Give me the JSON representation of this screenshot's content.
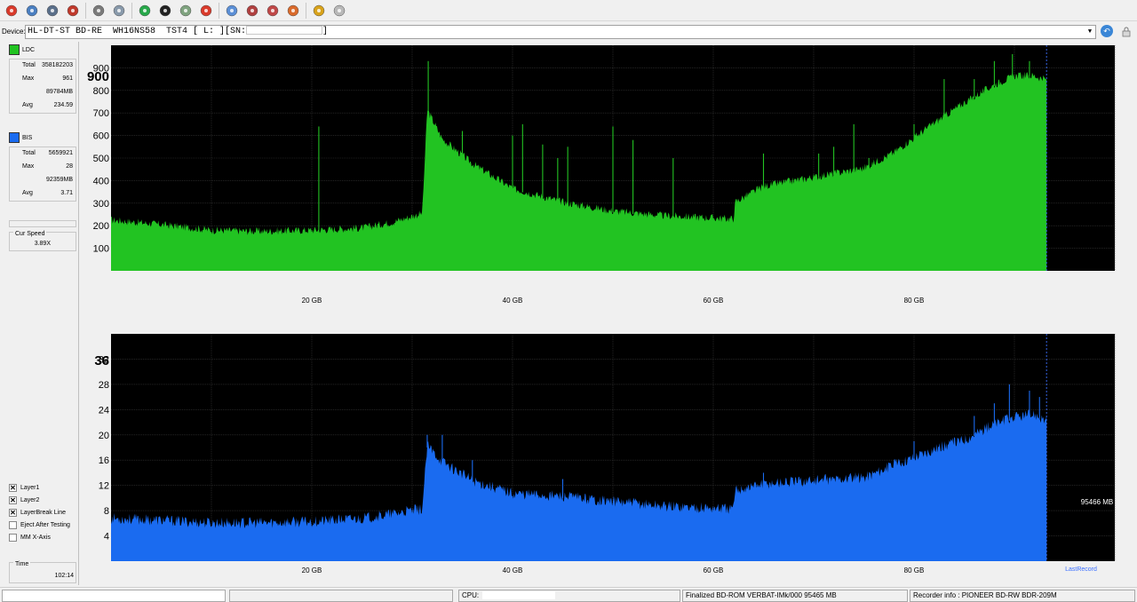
{
  "toolbar": {
    "buttons": [
      {
        "icon": "power-icon",
        "color": "#d93a2b"
      },
      {
        "icon": "disc-info-icon",
        "color": "#4a7fc1"
      },
      {
        "icon": "drive-icon",
        "color": "#5a6f8a"
      },
      {
        "icon": "erase-disc-icon",
        "color": "#c0392b"
      },
      {
        "icon": "drive-tray-icon",
        "color": "#7a7a7a"
      },
      {
        "icon": "copy-drive-icon",
        "color": "#8899aa"
      },
      {
        "icon": "refresh-icon",
        "color": "#27a84a"
      },
      {
        "icon": "start-icon",
        "color": "#222222"
      },
      {
        "icon": "rescan-icon",
        "color": "#7fa37f"
      },
      {
        "icon": "stop-icon",
        "color": "#d93a2b"
      },
      {
        "icon": "disc-blue-icon",
        "color": "#5b8fd6"
      },
      {
        "icon": "burn-disc-icon",
        "color": "#b04040"
      },
      {
        "icon": "disc-scan-icon",
        "color": "#c04848"
      },
      {
        "icon": "settings-disc-icon",
        "color": "#d96a2b"
      },
      {
        "icon": "chart-icon",
        "color": "#d8a21a"
      },
      {
        "icon": "tool-icon",
        "color": "#b8b8b8"
      }
    ]
  },
  "device": {
    "label": "Device:",
    "value_prefix": "HL-DT-ST BD-RE  WH16NS58  TST4 [ L: ][SN:",
    "value_suffix": "]"
  },
  "ldc": {
    "name": "LDC",
    "color": "#22c322",
    "total_label": "Total",
    "total": "358182203",
    "max_label": "Max",
    "max": "961",
    "max_pos": "89784MB",
    "avg_label": "Avg",
    "avg": "234.59"
  },
  "bis": {
    "name": "BIS",
    "color": "#1a6bf0",
    "total_label": "Total",
    "total": "5659921",
    "max_label": "Max",
    "max": "28",
    "max_pos": "92359MB",
    "avg_label": "Avg",
    "avg": "3.71"
  },
  "cur_speed": {
    "label": "Cur Speed",
    "value": "3.89X"
  },
  "options": [
    {
      "label": "Layer1",
      "checked": true
    },
    {
      "label": "Layer2",
      "checked": true
    },
    {
      "label": "LayerBreak Line",
      "checked": true
    },
    {
      "label": "Eject After Testing",
      "checked": false
    },
    {
      "label": "MM X-Axis",
      "checked": false
    }
  ],
  "time": {
    "label": "Time",
    "value": "102:14"
  },
  "chart_data": [
    {
      "type": "area",
      "series_name": "LDC",
      "color": "#22c322",
      "ylim": [
        0,
        1000
      ],
      "xlim_gb": [
        0,
        100
      ],
      "y_ticks": [
        "100",
        "200",
        "300",
        "400",
        "500",
        "600",
        "700",
        "800",
        "900"
      ],
      "y_tick_values": [
        100,
        200,
        300,
        400,
        500,
        600,
        700,
        800,
        900
      ],
      "y_max_label": "900",
      "x_ticks": [
        "20 GB",
        "40 GB",
        "60 GB",
        "80 GB"
      ],
      "x_tick_values": [
        20,
        40,
        60,
        80
      ],
      "data_end_gb": 93.2,
      "x": [
        0,
        5,
        10,
        15,
        20,
        25,
        28,
        31,
        31.5,
        33,
        36,
        40,
        45,
        50,
        55,
        62,
        62.2,
        65,
        70,
        75,
        78,
        82,
        85,
        88,
        90,
        92,
        93.2
      ],
      "y": [
        220,
        200,
        175,
        170,
        175,
        185,
        210,
        250,
        710,
        580,
        470,
        360,
        300,
        260,
        240,
        225,
        300,
        370,
        410,
        450,
        520,
        650,
        740,
        820,
        860,
        860,
        840
      ],
      "spikes_x": [
        20.7,
        31.6,
        35,
        40,
        41,
        43,
        44.5,
        45.5,
        50,
        52,
        56,
        65,
        70.5,
        72,
        74,
        75.5,
        80,
        83,
        86,
        88,
        89.8,
        91.5
      ],
      "spikes_y": [
        640,
        930,
        620,
        600,
        650,
        560,
        500,
        550,
        640,
        580,
        500,
        520,
        520,
        550,
        650,
        500,
        650,
        850,
        850,
        930,
        961,
        930
      ]
    },
    {
      "type": "area",
      "series_name": "BIS",
      "color": "#1a6bf0",
      "ylim": [
        0,
        36
      ],
      "xlim_gb": [
        0,
        100
      ],
      "y_ticks": [
        "4",
        "8",
        "12",
        "16",
        "20",
        "24",
        "28",
        "32"
      ],
      "y_tick_values": [
        4,
        8,
        12,
        16,
        20,
        24,
        28,
        32
      ],
      "y_max_label": "36",
      "x_ticks": [
        "20 GB",
        "40 GB",
        "60 GB",
        "80 GB"
      ],
      "x_tick_values": [
        20,
        40,
        60,
        80
      ],
      "data_end_gb": 93.2,
      "x": [
        0,
        5,
        10,
        15,
        20,
        25,
        28,
        31,
        31.5,
        33,
        36,
        40,
        45,
        50,
        55,
        62,
        62.2,
        65,
        70,
        75,
        78,
        82,
        85,
        88,
        90,
        92,
        93.2
      ],
      "y": [
        6.5,
        6.2,
        5.8,
        5.8,
        6.0,
        6.5,
        7.2,
        8.0,
        18.0,
        15.5,
        12.5,
        10.5,
        10.0,
        9.2,
        8.5,
        8.0,
        11.0,
        12.0,
        12.5,
        13.0,
        15.0,
        17.5,
        19.0,
        21.5,
        22.5,
        23.0,
        22.0
      ],
      "spikes_x": [
        31.5,
        33,
        36,
        45,
        65,
        80,
        86,
        88,
        89.5,
        91.5,
        92.5
      ],
      "spikes_y": [
        20,
        20,
        16,
        13,
        14,
        19,
        23,
        25,
        28,
        27,
        26
      ],
      "annotation_size": "95466 MB",
      "annotation_last": "LastRecord"
    }
  ],
  "status": {
    "cpu_label": "CPU:",
    "disc_info": "Finalized   BD-ROM   VERBAT-IMk/000   95465 MB",
    "recorder_info": "Recorder info : PIONEER        BD-RW   BDR-209M"
  }
}
